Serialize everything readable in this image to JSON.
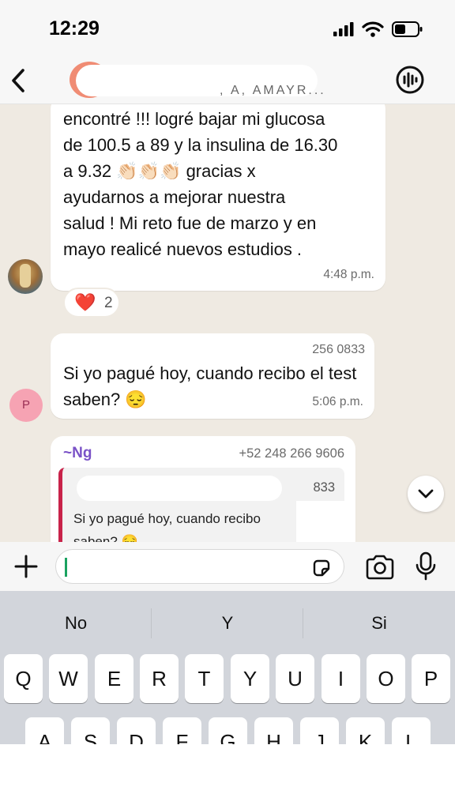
{
  "status_bar": {
    "time": "12:29"
  },
  "header": {
    "members_text": ", A, AMAYR..."
  },
  "messages": [
    {
      "text": "encontré !!! logré bajar mi glucosa\nde 100.5 a 89 y la insulina de 16.30\na 9.32 👏🏻👏🏻👏🏻 gracias x\nayudarnos a mejorar nuestra\nsalud ! Mi reto fue de marzo y en\nmayo realicé nuevos estudios .",
      "time": "4:48 p.m.",
      "reaction": {
        "emoji": "❤️",
        "count": "2"
      }
    },
    {
      "sender_number_partial": "256 0833",
      "text": "Si yo pagué hoy, cuando recibo el\ntest saben? 😔",
      "time": "5:06 p.m.",
      "avatar_initial": "P"
    },
    {
      "sender_name": "~Ng",
      "sender_phone": "+52 248 266 9606",
      "quote": {
        "number_partial": "833",
        "text": "Si yo pagué hoy, cuando recibo\nsaben? 😔"
      }
    }
  ],
  "keyboard": {
    "suggestions": [
      "No",
      "Y",
      "Si"
    ],
    "row1": [
      "Q",
      "W",
      "E",
      "R",
      "T",
      "Y",
      "U",
      "I",
      "O",
      "P"
    ],
    "row2": [
      "A",
      "S",
      "D",
      "F",
      "G",
      "H",
      "J",
      "K",
      "L"
    ]
  },
  "icons": {
    "back": "chevron-left-icon",
    "call": "call-waveform-icon",
    "add": "plus-icon",
    "sticker": "sticker-icon",
    "camera": "camera-icon",
    "mic": "microphone-icon",
    "scroll": "chevron-down-icon"
  },
  "colors": {
    "chat_background": "#efeae2",
    "bubble": "#ffffff",
    "quote_bar": "#c8234a",
    "sender_name": "#7a52c7",
    "cursor": "#1aa260",
    "keyboard": "#d2d5db"
  }
}
